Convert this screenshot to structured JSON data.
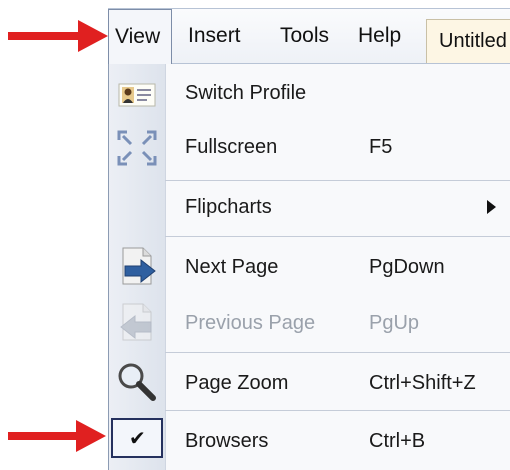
{
  "menubar": {
    "items": [
      {
        "label": "View"
      },
      {
        "label": "Insert"
      },
      {
        "label": "Tools"
      },
      {
        "label": "Help"
      }
    ],
    "tab_title": "Untitled"
  },
  "menu": {
    "items": [
      {
        "label": "Switch Profile",
        "shortcut": "",
        "icon": "profile-card-icon",
        "enabled": true
      },
      {
        "label": "Fullscreen",
        "shortcut": "F5",
        "icon": "fullscreen-icon",
        "enabled": true
      },
      {
        "label": "Flipcharts",
        "shortcut": "",
        "icon": "",
        "enabled": true,
        "submenu": true
      },
      {
        "label": "Next Page",
        "shortcut": "PgDown",
        "icon": "next-page-icon",
        "enabled": true
      },
      {
        "label": "Previous Page",
        "shortcut": "PgUp",
        "icon": "previous-page-icon",
        "enabled": false
      },
      {
        "label": "Page Zoom",
        "shortcut": "Ctrl+Shift+Z",
        "icon": "magnifier-icon",
        "enabled": true
      },
      {
        "label": "Browsers",
        "shortcut": "Ctrl+B",
        "icon": "checkmark-icon",
        "enabled": true,
        "checked": true
      }
    ]
  },
  "colors": {
    "annotation_arrow": "#e02020",
    "disabled_text": "#9aa1ab"
  }
}
